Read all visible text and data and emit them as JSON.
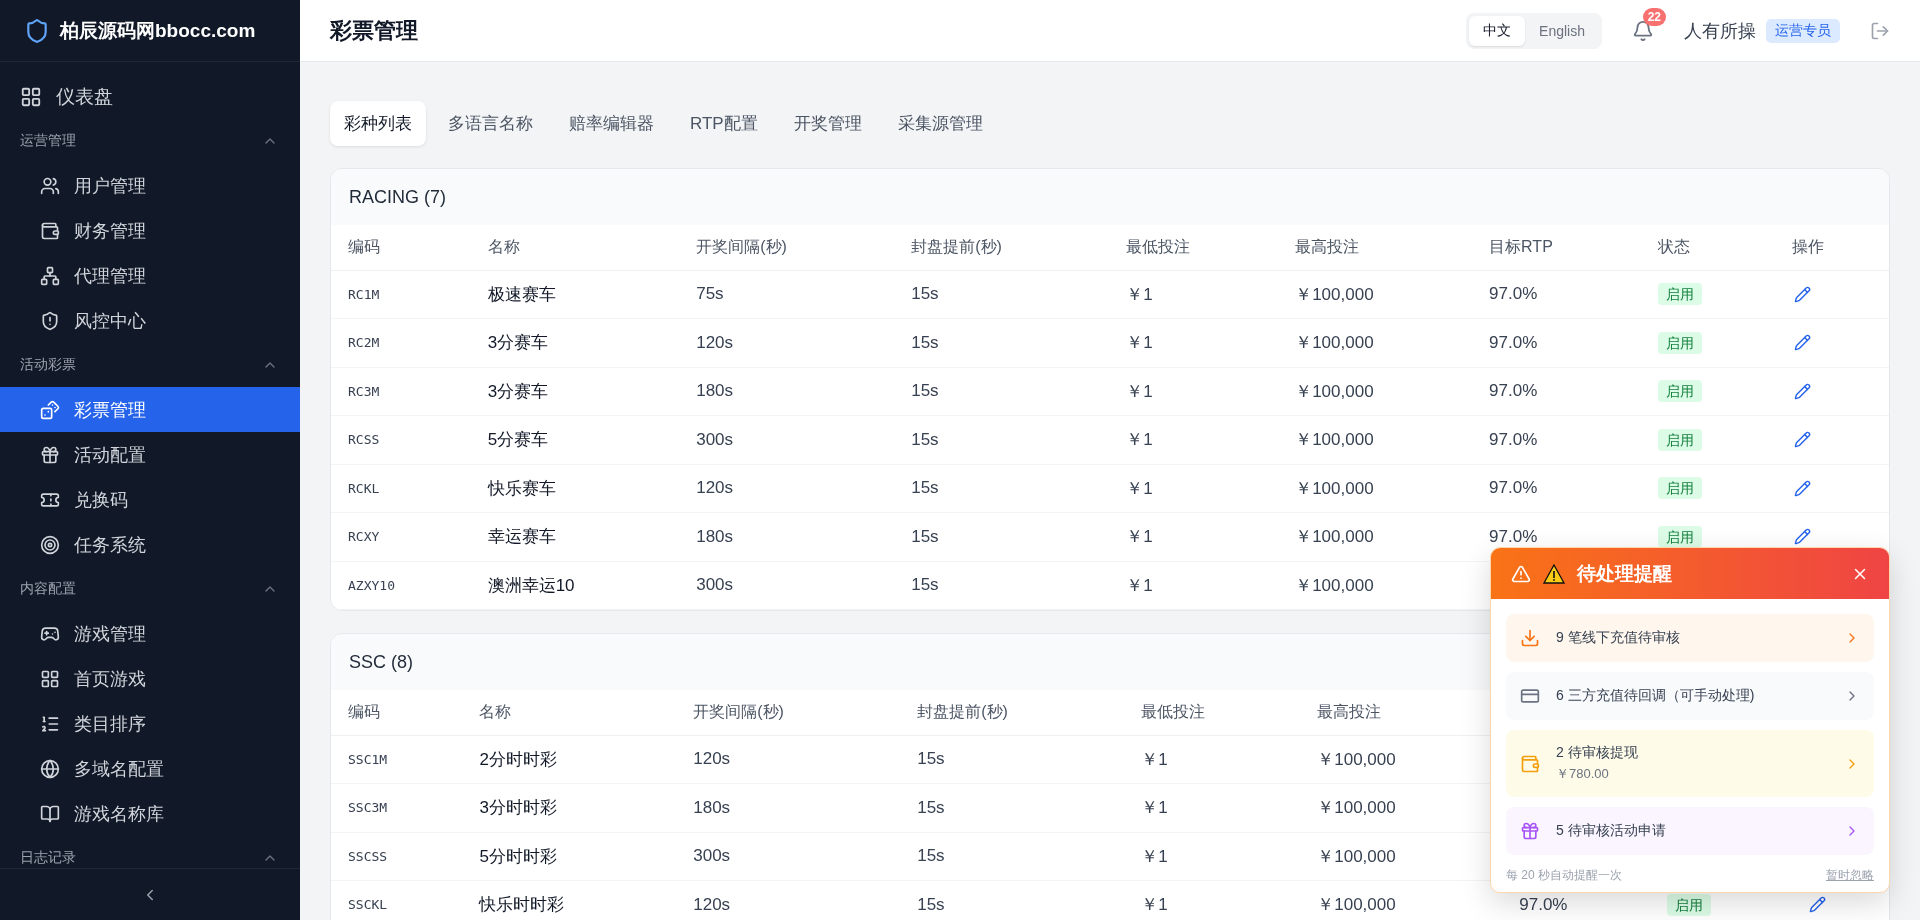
{
  "sidebar": {
    "logo": "柏辰源码网bbocc.com",
    "top_items": [
      {
        "label": "仪表盘",
        "selected": false
      }
    ],
    "sections": [
      {
        "title": "运营管理",
        "expanded": true,
        "items": [
          {
            "label": "用户管理",
            "selected": false
          },
          {
            "label": "财务管理",
            "selected": false
          },
          {
            "label": "代理管理",
            "selected": false
          },
          {
            "label": "风控中心",
            "selected": false
          }
        ]
      },
      {
        "title": "活动彩票",
        "expanded": true,
        "items": [
          {
            "label": "彩票管理",
            "selected": true
          },
          {
            "label": "活动配置",
            "selected": false
          },
          {
            "label": "兑换码",
            "selected": false
          },
          {
            "label": "任务系统",
            "selected": false
          }
        ]
      },
      {
        "title": "内容配置",
        "expanded": true,
        "items": [
          {
            "label": "游戏管理",
            "selected": false
          },
          {
            "label": "首页游戏",
            "selected": false
          },
          {
            "label": "类目排序",
            "selected": false
          },
          {
            "label": "多域名配置",
            "selected": false
          },
          {
            "label": "游戏名称库",
            "selected": false
          }
        ]
      },
      {
        "title": "日志记录",
        "expanded": true
      }
    ]
  },
  "header": {
    "title": "彩票管理",
    "languages": [
      {
        "label": "中文",
        "selected": true
      },
      {
        "label": "English",
        "selected": false
      }
    ],
    "notification_count": "22",
    "user": "人有所操",
    "role": "运营专员"
  },
  "tabs": [
    {
      "label": "彩种列表",
      "selected": true
    },
    {
      "label": "多语言名称",
      "selected": false
    },
    {
      "label": "赔率编辑器",
      "selected": false
    },
    {
      "label": "RTP配置",
      "selected": false
    },
    {
      "label": "开奖管理",
      "selected": false
    },
    {
      "label": "采集源管理",
      "selected": false
    }
  ],
  "tables": [
    {
      "title": "RACING (7)",
      "columns": [
        "编码",
        "名称",
        "开奖间隔(秒)",
        "封盘提前(秒)",
        "最低投注",
        "最高投注",
        "目标RTP",
        "状态",
        "操作"
      ],
      "rows": [
        {
          "code": "RC1M",
          "name": "极速赛车",
          "interval": "75s",
          "lock": "15s",
          "min": "￥1",
          "max": "￥100,000",
          "rtp": "97.0%",
          "status": "启用",
          "edit": true
        },
        {
          "code": "RC2M",
          "name": "3分赛车",
          "interval": "120s",
          "lock": "15s",
          "min": "￥1",
          "max": "￥100,000",
          "rtp": "97.0%",
          "status": "启用",
          "edit": true
        },
        {
          "code": "RC3M",
          "name": "3分赛车",
          "interval": "180s",
          "lock": "15s",
          "min": "￥1",
          "max": "￥100,000",
          "rtp": "97.0%",
          "status": "启用",
          "edit": true
        },
        {
          "code": "RCSS",
          "name": "5分赛车",
          "interval": "300s",
          "lock": "15s",
          "min": "￥1",
          "max": "￥100,000",
          "rtp": "97.0%",
          "status": "启用",
          "edit": true
        },
        {
          "code": "RCKL",
          "name": "快乐赛车",
          "interval": "120s",
          "lock": "15s",
          "min": "￥1",
          "max": "￥100,000",
          "rtp": "97.0%",
          "status": "启用",
          "edit": true
        },
        {
          "code": "RCXY",
          "name": "幸运赛车",
          "interval": "180s",
          "lock": "15s",
          "min": "￥1",
          "max": "￥100,000",
          "rtp": "97.0%",
          "status": "启用",
          "edit": true
        },
        {
          "code": "AZXY10",
          "name": "澳洲幸运10",
          "interval": "300s",
          "lock": "15s",
          "min": "￥1",
          "max": "￥100,000"
        }
      ]
    },
    {
      "title": "SSC (8)",
      "columns": [
        "编码",
        "名称",
        "开奖间隔(秒)",
        "封盘提前(秒)",
        "最低投注",
        "最高投注"
      ],
      "rows": [
        {
          "code": "SSC1M",
          "name": "2分时时彩",
          "interval": "120s",
          "lock": "15s",
          "min": "￥1",
          "max": "￥100,000"
        },
        {
          "code": "SSC3M",
          "name": "3分时时彩",
          "interval": "180s",
          "lock": "15s",
          "min": "￥1",
          "max": "￥100,000"
        },
        {
          "code": "SSCSS",
          "name": "5分时时彩",
          "interval": "300s",
          "lock": "15s",
          "min": "￥1",
          "max": "￥100,000"
        },
        {
          "code": "SSCKL",
          "name": "快乐时时彩",
          "interval": "120s",
          "lock": "15s",
          "min": "￥1",
          "max": "￥100,000",
          "rtp": "97.0%",
          "status": "启用",
          "edit": true
        }
      ]
    }
  ],
  "reminder": {
    "title": "待处理提醒",
    "items": [
      {
        "kind": "deposit",
        "text": "9 笔线下充值待审核"
      },
      {
        "kind": "callback",
        "text": "6 三方充值待回调（可手动处理)"
      },
      {
        "kind": "withdraw",
        "text": "2 待审核提现",
        "amount": "￥780.00"
      },
      {
        "kind": "activity",
        "text": "5 待审核活动申请"
      }
    ],
    "footer": "每 20 秒自动提醒一次",
    "dismiss": "暂时忽略"
  }
}
